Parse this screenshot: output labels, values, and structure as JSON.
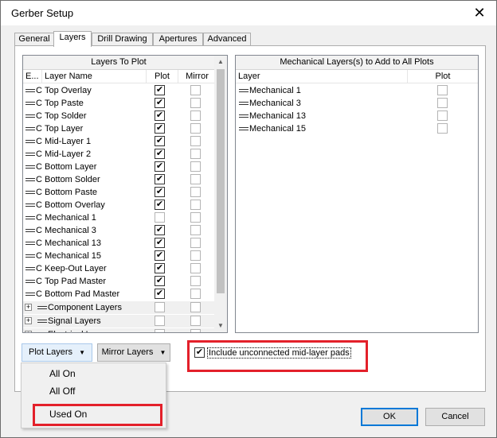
{
  "window": {
    "title": "Gerber Setup"
  },
  "tabs": [
    "General",
    "Layers",
    "Drill Drawing",
    "Apertures",
    "Advanced"
  ],
  "layers_to_plot": {
    "title": "Layers To Plot",
    "columns": [
      "E...",
      "Layer Name",
      "Plot",
      "Mirror"
    ],
    "rows": [
      {
        "prefix": "C",
        "name": "Top Overlay",
        "plot": true
      },
      {
        "prefix": "C",
        "name": "Top Paste",
        "plot": true
      },
      {
        "prefix": "C",
        "name": "Top Solder",
        "plot": true
      },
      {
        "prefix": "C",
        "name": "Top Layer",
        "plot": true
      },
      {
        "prefix": "C",
        "name": "Mid-Layer 1",
        "plot": true
      },
      {
        "prefix": "C",
        "name": "Mid-Layer 2",
        "plot": true
      },
      {
        "prefix": "C",
        "name": "Bottom Layer",
        "plot": true
      },
      {
        "prefix": "C",
        "name": "Bottom Solder",
        "plot": true
      },
      {
        "prefix": "C",
        "name": "Bottom Paste",
        "plot": true
      },
      {
        "prefix": "C",
        "name": "Bottom Overlay",
        "plot": true
      },
      {
        "prefix": "C",
        "name": "Mechanical 1",
        "plot": false
      },
      {
        "prefix": "C",
        "name": "Mechanical 3",
        "plot": true
      },
      {
        "prefix": "C",
        "name": "Mechanical 13",
        "plot": true
      },
      {
        "prefix": "C",
        "name": "Mechanical 15",
        "plot": true
      },
      {
        "prefix": "C",
        "name": "Keep-Out Layer",
        "plot": true
      },
      {
        "prefix": "C",
        "name": "Top Pad Master",
        "plot": true
      },
      {
        "prefix": "C",
        "name": "Bottom Pad Master",
        "plot": true
      }
    ],
    "groups": [
      {
        "name": "Component Layers"
      },
      {
        "name": "Signal Layers"
      },
      {
        "name": "Electrical Layers"
      }
    ]
  },
  "mechanical_layers": {
    "title": "Mechanical Layers(s) to Add to All Plots",
    "columns": [
      "Layer",
      "Plot"
    ],
    "rows": [
      {
        "name": "Mechanical 1",
        "plot": false
      },
      {
        "name": "Mechanical 3",
        "plot": false
      },
      {
        "name": "Mechanical 13",
        "plot": false
      },
      {
        "name": "Mechanical 15",
        "plot": false
      }
    ]
  },
  "buttons": {
    "plot_layers": "Plot Layers",
    "mirror_layers": "Mirror Layers",
    "ok": "OK",
    "cancel": "Cancel"
  },
  "popup_menu": [
    "All On",
    "All Off",
    "Used On"
  ],
  "include_unconnected": {
    "label": "Include unconnected mid-layer pads",
    "checked": true
  },
  "colors": {
    "highlight": "#e3202a",
    "accent": "#0078d7"
  }
}
